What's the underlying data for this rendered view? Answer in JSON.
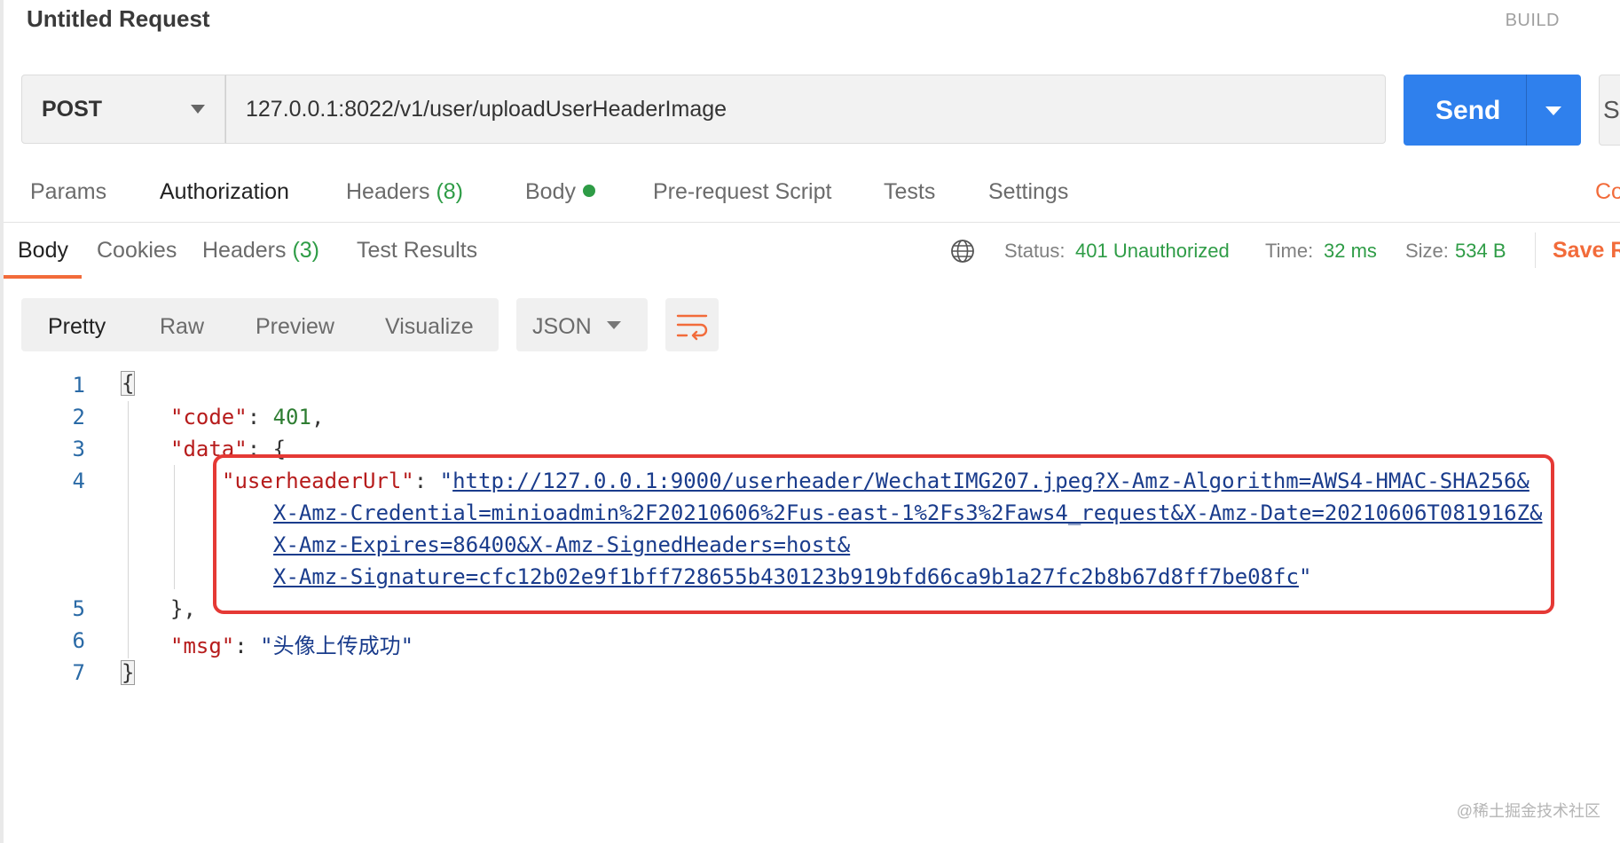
{
  "header": {
    "title": "Untitled Request",
    "build_label": "BUILD"
  },
  "request": {
    "method": "POST",
    "url": "127.0.0.1:8022/v1/user/uploadUserHeaderImage",
    "send_label": "Send",
    "save_partial": "S"
  },
  "request_tabs": {
    "params": "Params",
    "authorization": "Authorization",
    "headers": "Headers",
    "headers_count": "(8)",
    "body": "Body",
    "prerequest": "Pre-request Script",
    "tests": "Tests",
    "settings": "Settings",
    "cookies_partial": "Co"
  },
  "response_tabs": {
    "body": "Body",
    "cookies": "Cookies",
    "headers": "Headers",
    "headers_count": "(3)",
    "test_results": "Test Results"
  },
  "status": {
    "status_label": "Status:",
    "status_value": "401 Unauthorized",
    "time_label": "Time:",
    "time_value": "32 ms",
    "size_label": "Size:",
    "size_value": "534 B",
    "save_response_partial": "Save R"
  },
  "view": {
    "pretty": "Pretty",
    "raw": "Raw",
    "preview": "Preview",
    "visualize": "Visualize",
    "language": "JSON"
  },
  "code": {
    "line_numbers": [
      "1",
      "2",
      "3",
      "4",
      "5",
      "6",
      "7"
    ],
    "open_brace": "{",
    "code_key": "\"code\"",
    "code_value": "401",
    "data_key": "\"data\"",
    "data_open": "{",
    "url_key": "\"userheaderUrl\"",
    "url_line1": "http://127.0.0.1:9000/userheader/WechatIMG207.jpeg?X-Amz-Algorithm=AWS4-HMAC-SHA256&",
    "url_line2": "X-Amz-Credential=minioadmin%2F20210606%2Fus-east-1%2Fs3%2Faws4_request&X-Amz-Date=20210606T081916Z&",
    "url_line3": "X-Amz-Expires=86400&X-Amz-SignedHeaders=host&",
    "url_line4": "X-Amz-Signature=cfc12b02e9f1bff728655b430123b919bfd66ca9b1a27fc2b8b67d8ff7be08fc",
    "data_close": "},",
    "msg_key": "\"msg\"",
    "msg_value": "\"头像上传成功\"",
    "close_brace": "}"
  },
  "watermark": "@稀土掘金技术社区",
  "colors": {
    "accent_orange": "#f26b3a",
    "send_blue": "#2f80ed",
    "success_green": "#2e9c46",
    "highlight_red": "#e53935"
  }
}
